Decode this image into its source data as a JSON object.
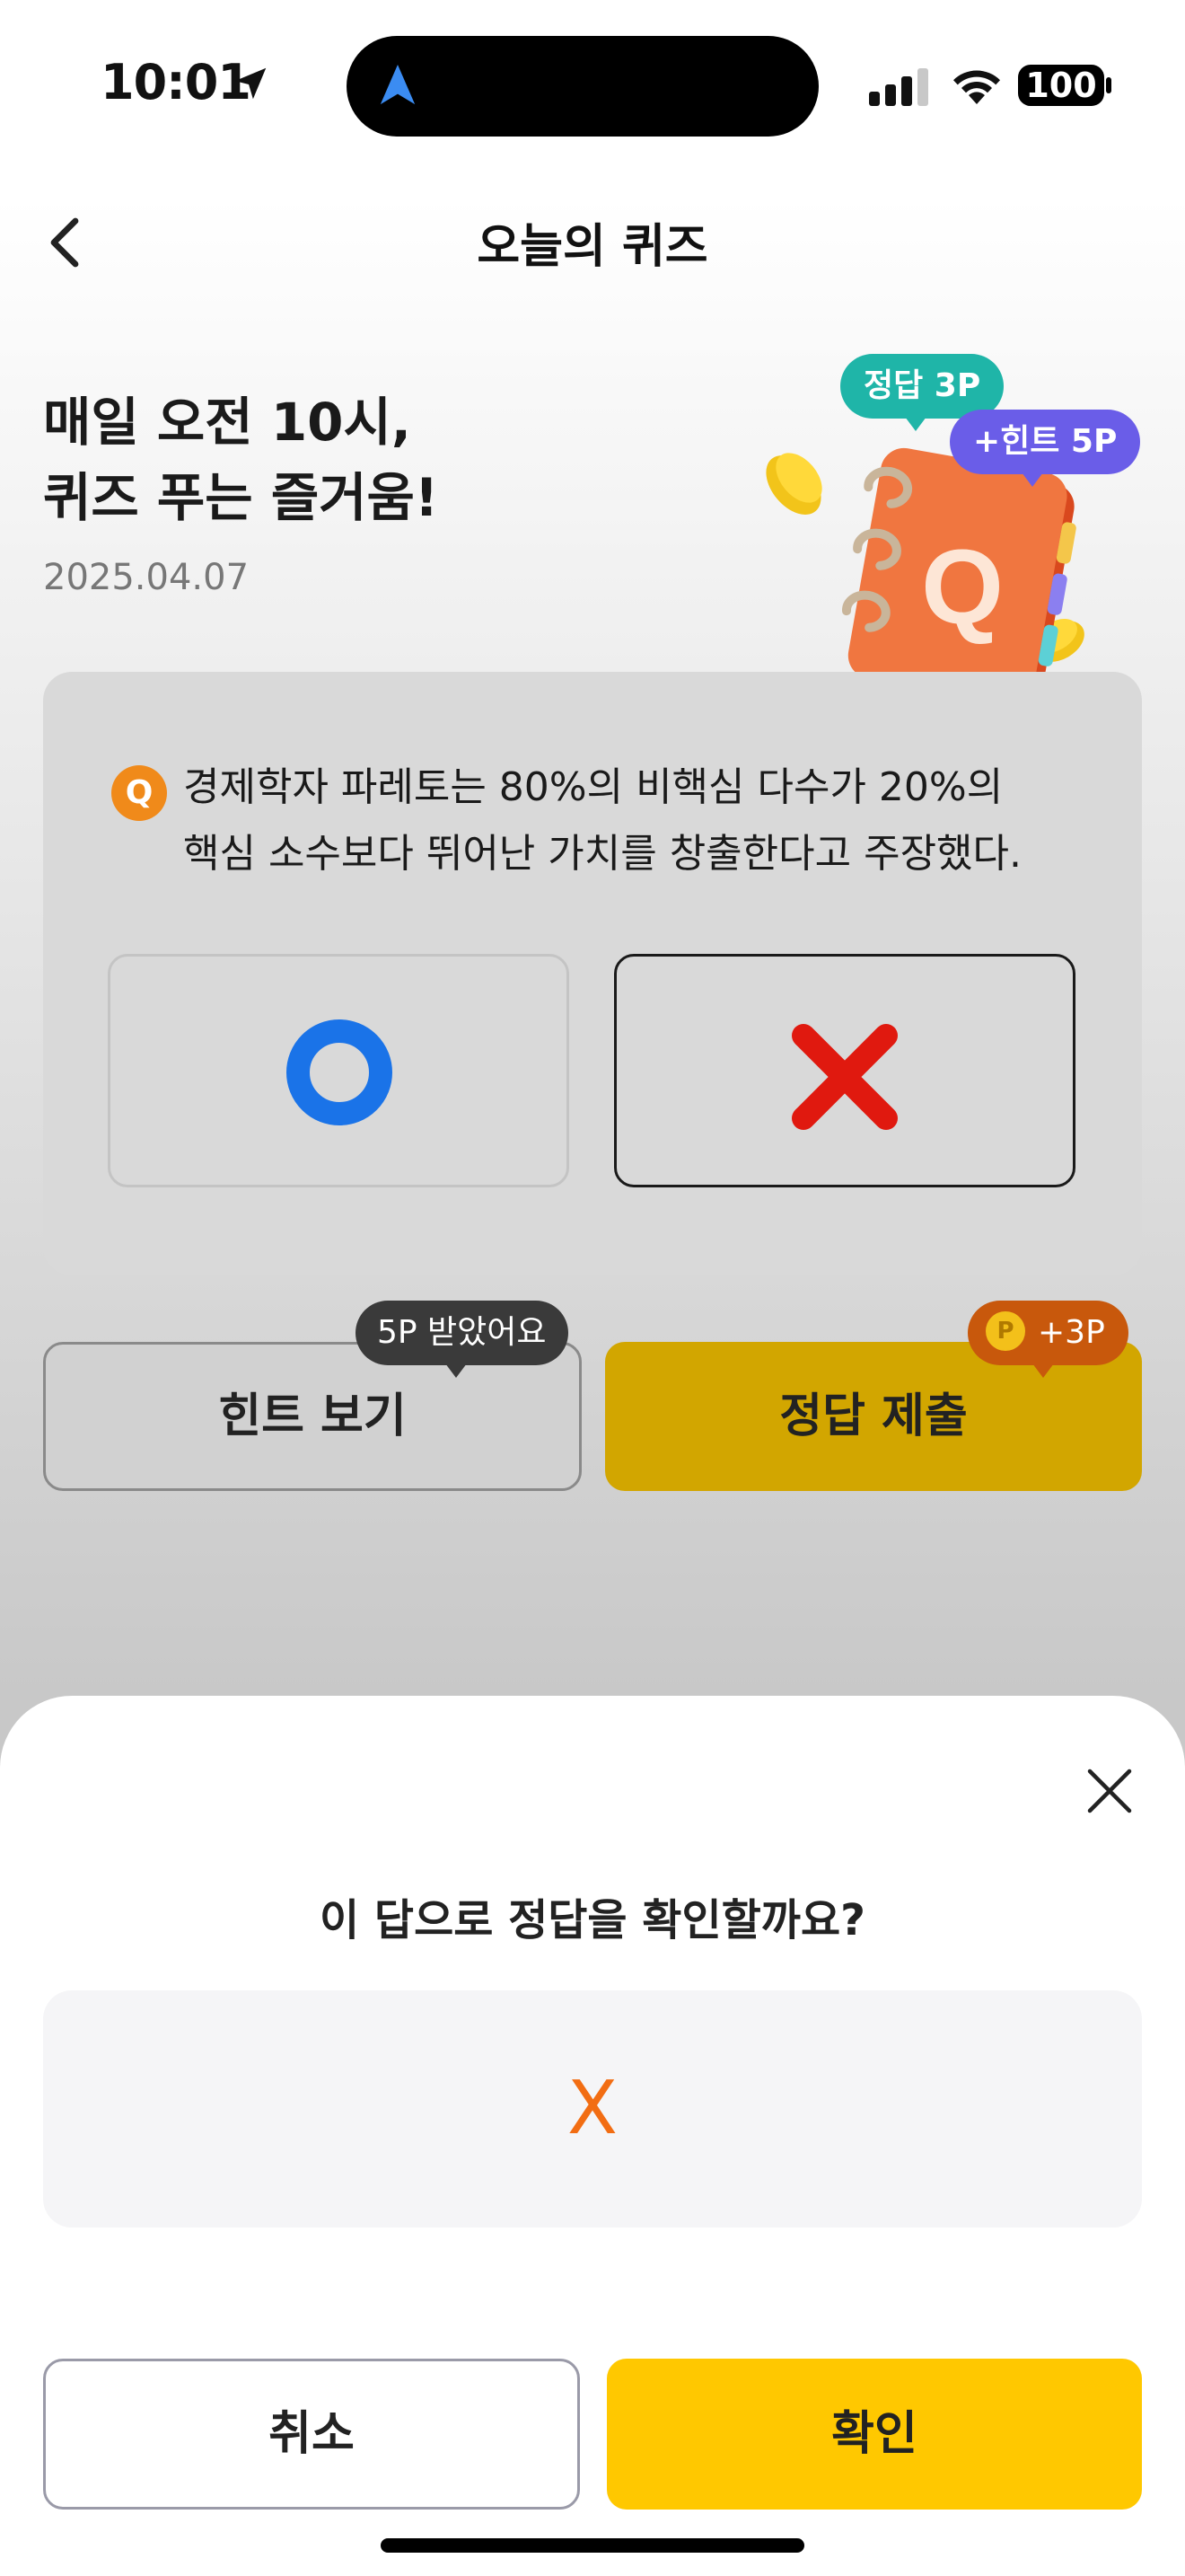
{
  "status_bar": {
    "time": "10:01",
    "battery": "100"
  },
  "header": {
    "title": "오늘의 퀴즈"
  },
  "hero": {
    "headline_line1": "매일 오전 10시,",
    "headline_line2": "퀴즈 푸는 즐거움!",
    "date": "2025.04.07",
    "tag_answer": "정답 3P",
    "tag_hint": "+힌트 5P",
    "book_letter": "Q"
  },
  "quiz": {
    "badge": "Q",
    "question_line1": "경제학자 파레토는 80%의 비핵심 다수가 20%의",
    "question_line2": "핵심 소수보다 뛰어난 가치를 창출한다고 주장했다.",
    "selected_option": "X"
  },
  "actions": {
    "hint_label": "힌트 보기",
    "hint_bubble": "5P 받았어요",
    "submit_label": "정답 제출",
    "reward_coin": "P",
    "reward_bubble": "+3P"
  },
  "sheet": {
    "question": "이 답으로 정답을 확인할까요?",
    "answer": "X",
    "cancel_label": "취소",
    "confirm_label": "확인"
  },
  "colors": {
    "accent_yellow": "#ffc800",
    "answer_orange": "#f26d13",
    "o_blue": "#1a73e8",
    "x_red": "#e0190f"
  }
}
